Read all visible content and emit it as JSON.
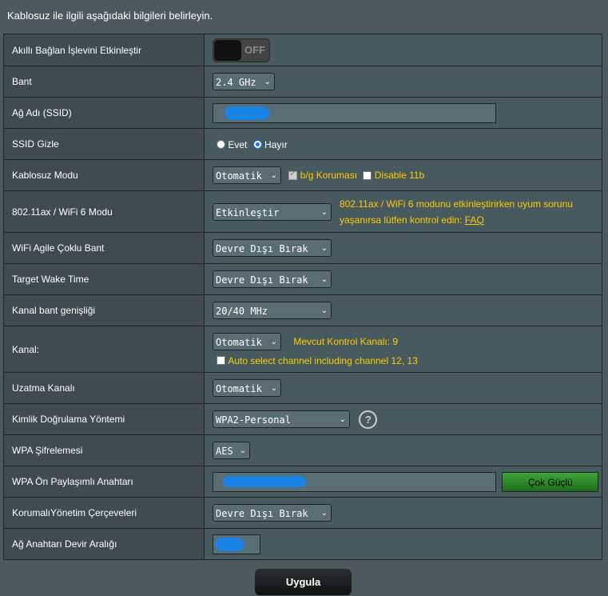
{
  "header": "Kablosuz ile ilgili aşağıdaki bilgileri belirleyin.",
  "rows": {
    "smart_connect": {
      "label": "Akıllı Bağlan İşlevini Etkinleştir",
      "toggle": "OFF"
    },
    "band": {
      "label": "Bant",
      "value": "2.4 GHz"
    },
    "ssid": {
      "label": "Ağ Adı (SSID)",
      "value": ""
    },
    "hide_ssid": {
      "label": "SSID Gizle",
      "opt_yes": "Evet",
      "opt_no": "Hayır",
      "selected": "Hayır"
    },
    "wireless_mode": {
      "label": "Kablosuz Modu",
      "value": "Otomatik",
      "bg_protection": "b/g Koruması",
      "disable_11b": "Disable 11b"
    },
    "wifi6": {
      "label": "802.11ax / WiFi 6 Modu",
      "value": "Etkinleştir",
      "note": "802.11ax / WiFi 6 modunu etkinleştirirken uyum sorunu yaşanırsa lütfen kontrol edin:",
      "faq": "FAQ"
    },
    "agile": {
      "label": "WiFi Agile Çoklu Bant",
      "value": "Devre Dışı Bırak"
    },
    "twt": {
      "label": "Target Wake Time",
      "value": "Devre Dışı Bırak"
    },
    "bandwidth": {
      "label": "Kanal bant genişliği",
      "value": "20/40 MHz"
    },
    "channel": {
      "label": "Kanal:",
      "value": "Otomatik",
      "current": "Mevcut Kontrol Kanalı: 9",
      "auto_select": "Auto select channel including channel 12, 13"
    },
    "ext_channel": {
      "label": "Uzatma Kanalı",
      "value": "Otomatik"
    },
    "auth": {
      "label": "Kimlik Doğrulama Yöntemi",
      "value": "WPA2-Personal"
    },
    "wpa_enc": {
      "label": "WPA Şifrelemesi",
      "value": "AES"
    },
    "psk": {
      "label": "WPA Ön Paylaşımlı Anahtarı",
      "value": "",
      "strength": "Çok Güçlü"
    },
    "pmf": {
      "label": "KorumalıYönetim Çerçeveleri",
      "value": "Devre Dışı Bırak"
    },
    "rekey": {
      "label": "Ağ Anahtarı Devir Aralığı",
      "value": ""
    }
  },
  "apply_label": "Uygula",
  "colors": {
    "accent_yellow": "#ffcc00",
    "strength_green": "#3fa63a",
    "background": "#4d595d"
  }
}
